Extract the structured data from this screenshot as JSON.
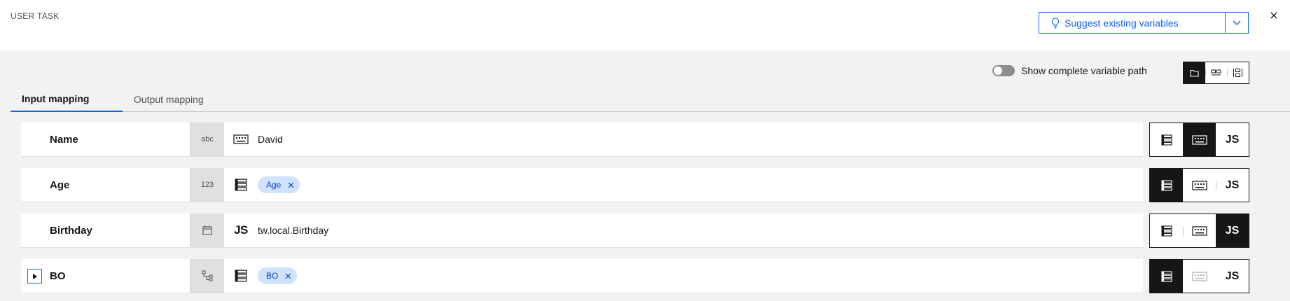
{
  "header": {
    "title": "USER TASK",
    "suggest_label": "Suggest existing variables",
    "suggest_icon": "lightbulb-icon",
    "close_icon": "close-icon"
  },
  "toolbar": {
    "toggle_label": "Show complete variable path",
    "toggle_on": false,
    "view_modes": [
      "folder-view-icon",
      "card-view-icon",
      "column-view-icon"
    ],
    "active_view": 0
  },
  "tabs": [
    {
      "label": "Input mapping",
      "active": true
    },
    {
      "label": "Output mapping",
      "active": false
    }
  ],
  "rows": [
    {
      "name": "Name",
      "type_label": "abc",
      "mode": "keyboard",
      "value_text": "David"
    },
    {
      "name": "Age",
      "type_label": "123",
      "mode": "variable",
      "tag": "Age"
    },
    {
      "name": "Birthday",
      "type_label": "calendar-icon",
      "mode": "js",
      "js_label": "JS",
      "value_text": "tw.local.Birthday"
    },
    {
      "name": "BO",
      "type_label": "object-tree-icon",
      "mode": "variable",
      "tag": "BO",
      "expandable": true
    }
  ],
  "mode_buttons": {
    "js_label": "JS"
  },
  "colors": {
    "accent": "#0f62fe",
    "tag_bg": "#d0e2ff",
    "dark": "#161616"
  }
}
